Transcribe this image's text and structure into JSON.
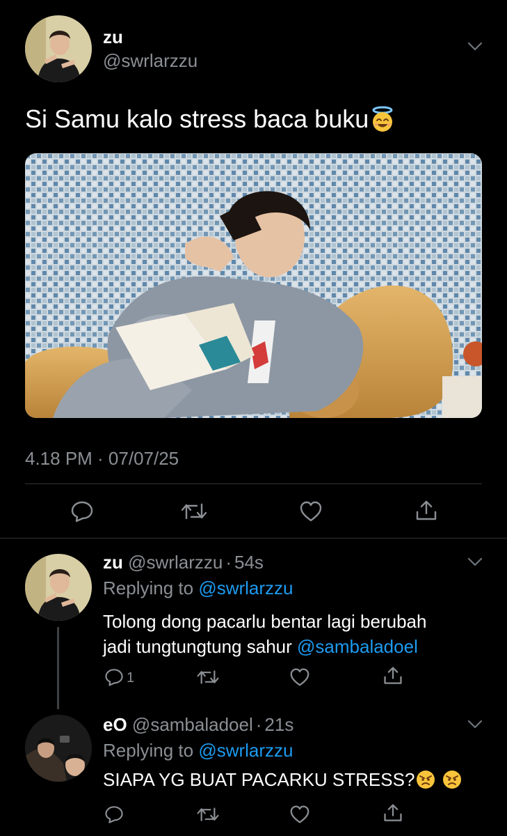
{
  "tweet": {
    "author_name": "zu",
    "author_handle": "@swrlarzzu",
    "text": "Si Samu kalo stress baca buku",
    "text_emoji": "smiling-face-with-halo",
    "timestamp": "4.18 PM · 07/07/25"
  },
  "replies": [
    {
      "author_name": "zu",
      "author_handle": "@swrlarzzu",
      "separator": "·",
      "time": "54s",
      "replying_prefix": "Replying to",
      "replying_to": "@swrlarzzu",
      "text_line1": "Tolong dong pacarlu bentar lagi berubah",
      "text_line2": "jadi tungtungtung sahur",
      "mention": "@sambaladoel",
      "reply_count": "1"
    },
    {
      "author_name": "eO",
      "author_handle": "@sambaladoel",
      "separator": "·",
      "time": "21s",
      "replying_prefix": "Replying to",
      "replying_to": "@swrlarzzu",
      "text": "SIAPA YG BUAT PACARKU STRESS?",
      "text_emojis": [
        "angry-face",
        "angry-face"
      ]
    }
  ],
  "colors": {
    "background": "#000000",
    "text": "#ffffff",
    "muted": "#8b8f94",
    "link": "#1d9bf0",
    "divider": "#2f3336"
  }
}
